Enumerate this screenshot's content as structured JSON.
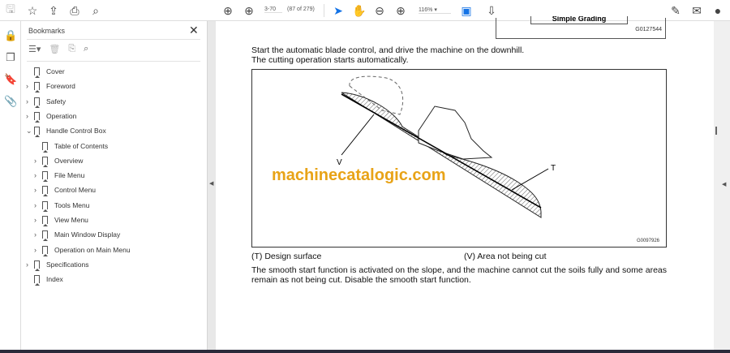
{
  "toolbar": {
    "page_input": "3-70",
    "page_count": "(87 of 279)",
    "zoom": "116%"
  },
  "bookmarks": {
    "title": "Bookmarks",
    "items": [
      {
        "label": "Cover",
        "level": 0,
        "expandable": false
      },
      {
        "label": "Foreword",
        "level": 0,
        "expandable": true
      },
      {
        "label": "Safety",
        "level": 0,
        "expandable": true
      },
      {
        "label": "Operation",
        "level": 0,
        "expandable": true
      },
      {
        "label": "Handle Control Box",
        "level": 0,
        "expandable": true,
        "expanded": true
      },
      {
        "label": "Table of Contents",
        "level": 1,
        "expandable": false
      },
      {
        "label": "Overview",
        "level": 1,
        "expandable": true
      },
      {
        "label": "File Menu",
        "level": 1,
        "expandable": true
      },
      {
        "label": "Control Menu",
        "level": 1,
        "expandable": true
      },
      {
        "label": "Tools Menu",
        "level": 1,
        "expandable": true
      },
      {
        "label": "View Menu",
        "level": 1,
        "expandable": true
      },
      {
        "label": "Main Window Display",
        "level": 1,
        "expandable": true
      },
      {
        "label": "Operation on Main Menu",
        "level": 1,
        "expandable": true
      },
      {
        "label": "Specifications",
        "level": 0,
        "expandable": true
      },
      {
        "label": "Index",
        "level": 0,
        "expandable": false
      }
    ]
  },
  "document": {
    "prev_figure_label": "Simple Grading",
    "prev_figure_code": "G0127544",
    "intro_line1": "Start the automatic blade control, and drive the machine on the downhill.",
    "intro_line2": "The cutting operation starts automatically.",
    "figure_code": "G0097926",
    "figure_label_v": "V",
    "figure_label_t": "T",
    "watermark": "machinecatalogic.com",
    "legend_t": "(T) Design surface",
    "legend_v": "(V) Area not being cut",
    "body_line1": "The smooth start function is activated on the slope, and the machine cannot cut the soils fully and some areas",
    "body_line2": "remain as not being cut. Disable the smooth start function."
  }
}
